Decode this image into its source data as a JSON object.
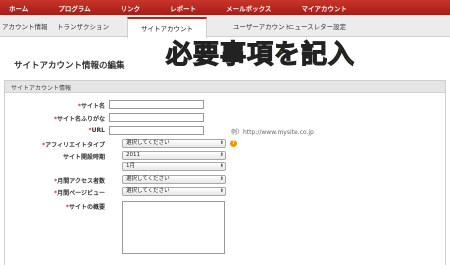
{
  "top_nav": [
    "ホーム",
    "プログラム",
    "リンク",
    "レポート",
    "メールボックス",
    "マイアカウント"
  ],
  "sub_nav": {
    "items": [
      "アカウント情報",
      "トランザクション",
      "サイトアカウント",
      "ユーザーアカウント",
      "ニュースレター設定"
    ],
    "active": "サイトアカウント"
  },
  "page": {
    "title": "サイトアカウント情報の編集",
    "overlay_caption": "必要事項を記入"
  },
  "panel": {
    "header": "サイトアカウント情報"
  },
  "form": {
    "site_name_label": "サイト名",
    "site_name_value": "",
    "site_kana_label": "サイト名ふりがな",
    "site_kana_value": "",
    "url_label": "URL",
    "url_value": "",
    "url_example": "例）http://www.mysite.co.jp",
    "affiliate_type_label": "アフィリエイトタイプ",
    "affiliate_type_value": "選択してください",
    "opening_label": "サイト開設時期",
    "opening_year_value": "2011",
    "opening_month_value": "1月",
    "monthly_visitors_label": "月間アクセス者数",
    "monthly_visitors_value": "選択してください",
    "monthly_pageviews_label": "月間ページビュー",
    "monthly_pageviews_value": "選択してください",
    "site_summary_label": "サイトの概要",
    "required_mark": "*",
    "help_icon_text": "?"
  },
  "colors": {
    "nav_red": "#b0271d",
    "overlay_orange": "#f28a00",
    "help_orange": "#f29400"
  }
}
